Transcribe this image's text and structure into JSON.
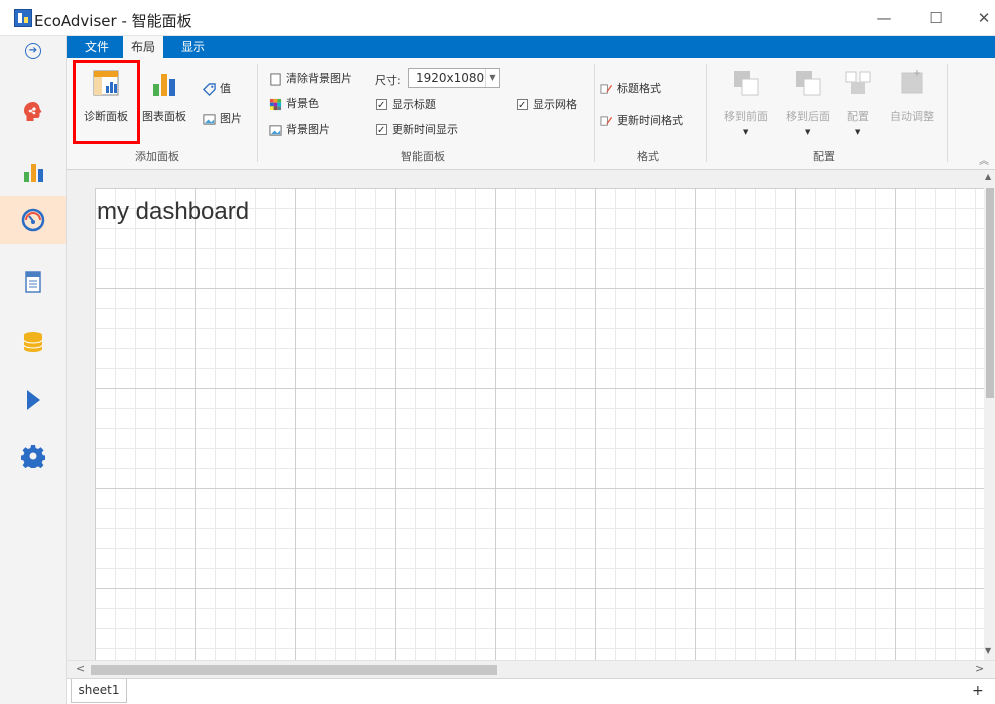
{
  "window": {
    "title": "EcoAdviser - 智能面板",
    "minimize": "—",
    "maximize": "☐",
    "close": "✕"
  },
  "ribbon": {
    "tabs": [
      "文件",
      "布局",
      "显示"
    ],
    "active_tab": "布局",
    "groups": {
      "add_panel": {
        "label": "添加面板",
        "diagnostic_panel": "诊断面板",
        "chart_panel": "图表面板",
        "value": "值",
        "picture": "图片"
      },
      "smart_panel": {
        "label": "智能面板",
        "clear_bg_image": "清除背景图片",
        "bg_color": "背景色",
        "bg_image": "背景图片",
        "size_label": "尺寸:",
        "size_value": "1920x1080",
        "show_title": "显示标题",
        "show_update_time": "更新时间显示",
        "show_grid": "显示网格",
        "show_title_checked": true,
        "show_update_time_checked": true,
        "show_grid_checked": true
      },
      "format": {
        "label": "格式",
        "title_format": "标题格式",
        "update_time_format": "更新时间格式"
      },
      "config": {
        "label": "配置",
        "bring_to_front": "移到前面",
        "send_to_back": "移到后面",
        "configure": "配置",
        "auto_adjust": "自动调整"
      }
    }
  },
  "sidebar": {
    "items": [
      {
        "name": "brain",
        "icon": "brain-icon",
        "color": "#e8533f"
      },
      {
        "name": "chart",
        "icon": "bar-chart-icon",
        "color": "#f0a020"
      },
      {
        "name": "dashboard",
        "icon": "gauge-icon",
        "color": "#2b6cc4",
        "active": true
      },
      {
        "name": "report",
        "icon": "document-icon",
        "color": "#4a7fc1"
      },
      {
        "name": "database",
        "icon": "database-icon",
        "color": "#f2b21c"
      },
      {
        "name": "run",
        "icon": "play-icon",
        "color": "#2b6cc4"
      },
      {
        "name": "settings",
        "icon": "gear-icon",
        "color": "#2b6cc4"
      }
    ]
  },
  "canvas": {
    "dashboard_title": "my dashboard"
  },
  "sheets": {
    "tabs": [
      "sheet1"
    ],
    "add": "+"
  },
  "colors": {
    "ribbon_blue": "#0071c6",
    "highlight": "#ff0000",
    "active_sidebar": "#fde5cf"
  }
}
